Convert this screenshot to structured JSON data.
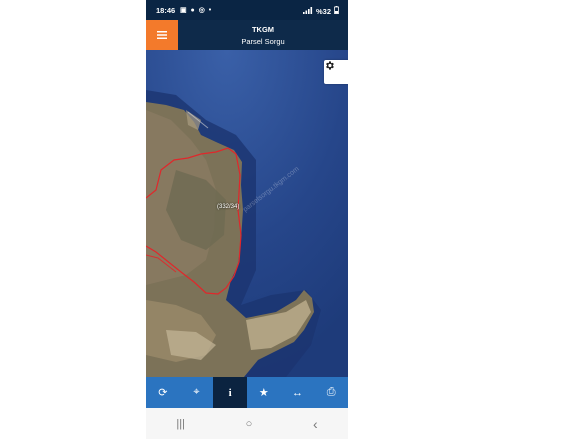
{
  "status_bar": {
    "time": "18:46",
    "battery": "%32",
    "note_icons": "▣ ● ◎ •"
  },
  "header": {
    "menu_icon": "hamburger-menu-icon",
    "title": "TKGM",
    "subtitle": "Parsel Sorgu"
  },
  "map": {
    "parcel_label": "(332/34)",
    "watermark": "parselsorgu.tkgm.com",
    "settings_icon": "gear-icon",
    "parcel_outline_color": "#e0272b"
  },
  "toolbar": {
    "buttons": [
      {
        "name": "refresh",
        "icon": "refresh-icon",
        "glyph": "⟳"
      },
      {
        "name": "locate",
        "icon": "crosshair-icon",
        "glyph": "⌖"
      },
      {
        "name": "info",
        "icon": "info-icon",
        "glyph": "i",
        "active": true
      },
      {
        "name": "favorite",
        "icon": "star-icon",
        "glyph": "★"
      },
      {
        "name": "measure",
        "icon": "measure-icon",
        "glyph": "↔"
      },
      {
        "name": "print",
        "icon": "print-icon",
        "glyph": "⎙"
      }
    ]
  },
  "nav_bar": {
    "recents": "|||",
    "home": "○",
    "back": "‹"
  },
  "colors": {
    "header_bg": "#0e2a4a",
    "menu_accent": "#f37a2b",
    "toolbar_bg": "#2b74c0",
    "toolbar_active": "#0b2340"
  }
}
